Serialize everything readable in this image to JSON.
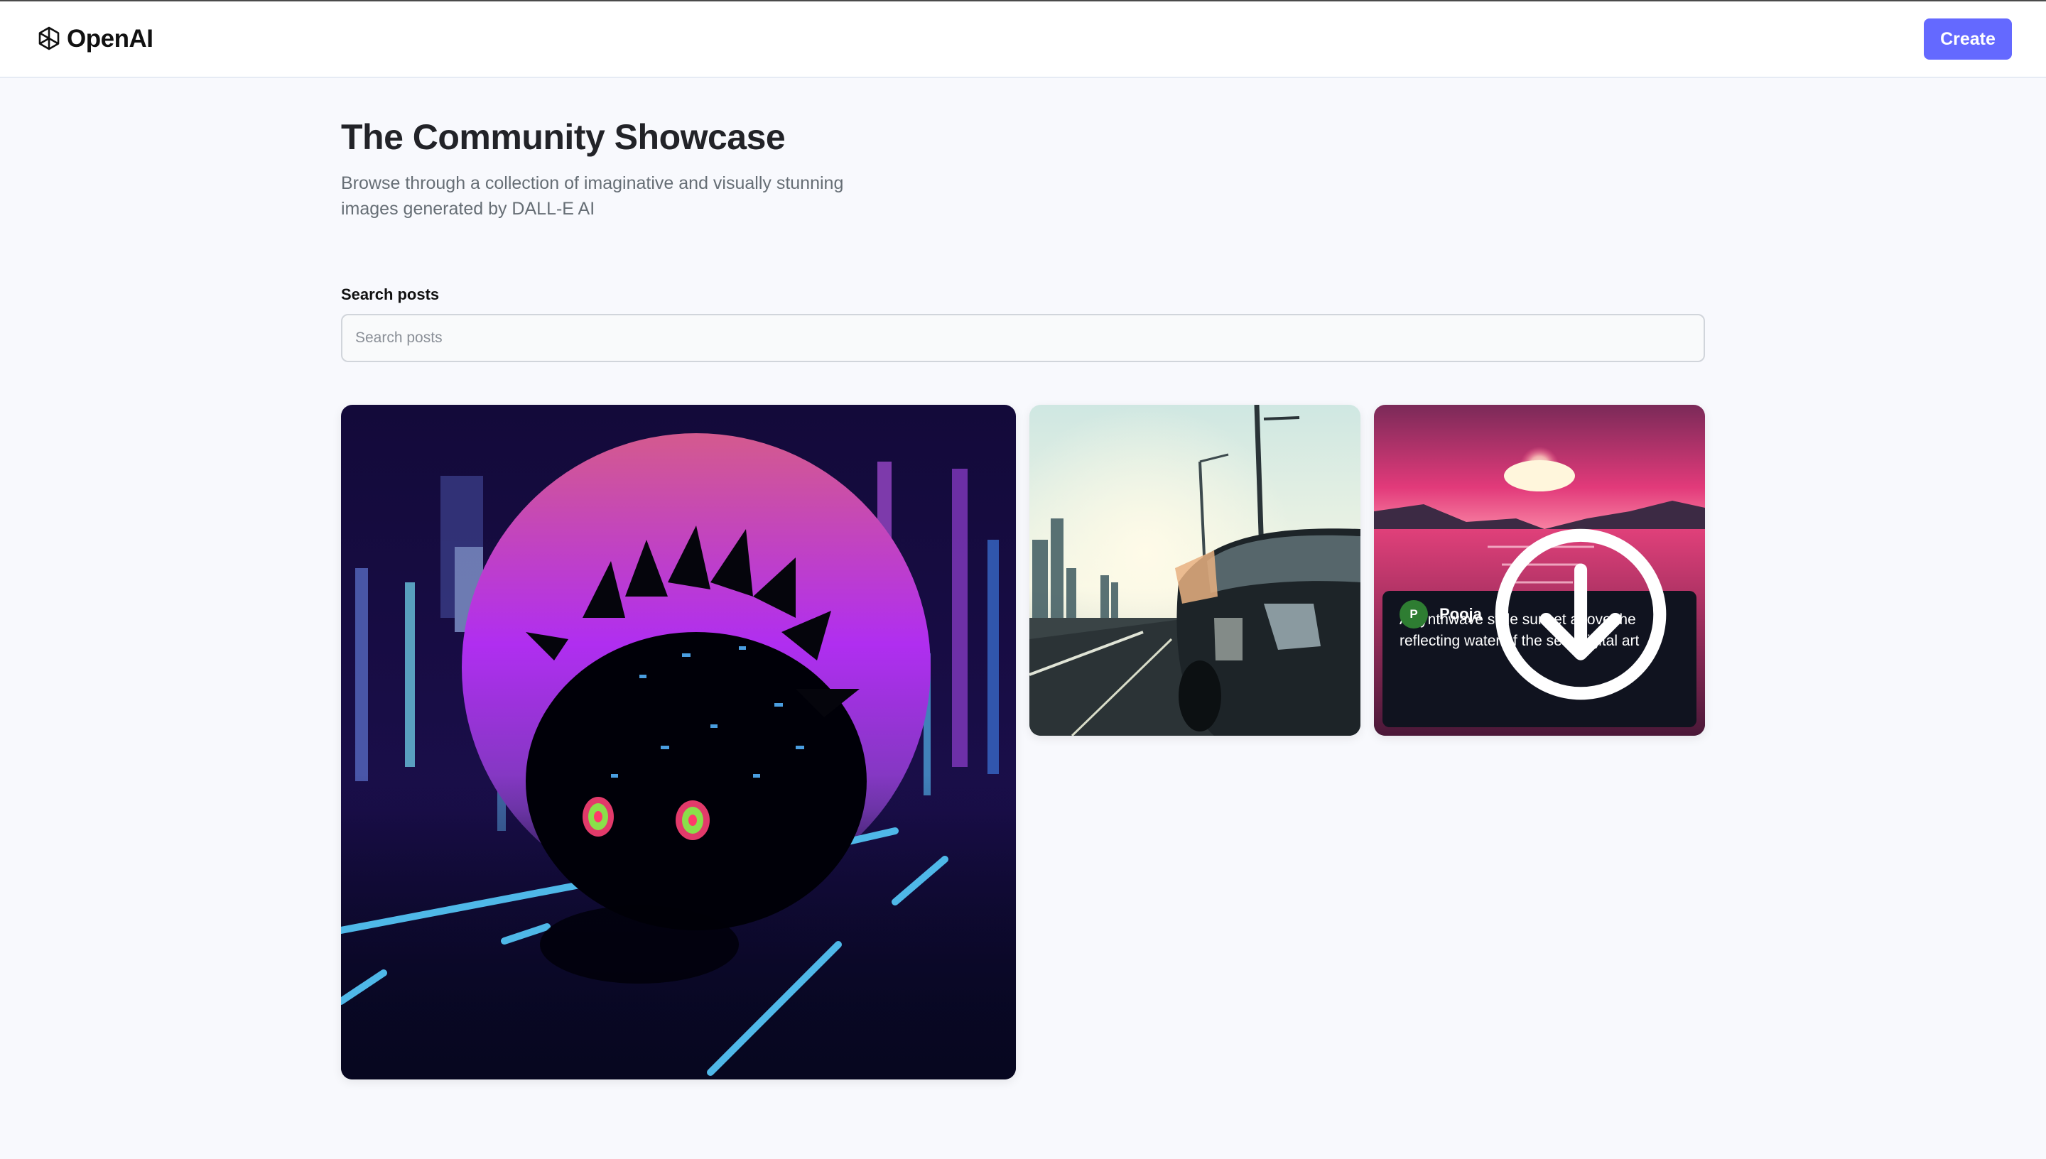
{
  "header": {
    "logo_text": "OpenAI",
    "create_label": "Create"
  },
  "page": {
    "title": "The Community Showcase",
    "subtitle": "Browse through a collection of imaginative and visually stunning images generated by DALL-E AI"
  },
  "search": {
    "label": "Search posts",
    "placeholder": "Search posts",
    "value": ""
  },
  "posts": [
    {
      "image": "synthwave hedgehog on neon road"
    },
    {
      "image": "car on highway at sunset"
    },
    {
      "image": "synthwave sunset over sea",
      "prompt": "A synthwave style sunset above the reflecting water of the sea, digital art",
      "author": "Pooja",
      "avatar_initial": "P",
      "avatar_color": "#2e7d32"
    }
  ],
  "colors": {
    "accent": "#6469ff",
    "background": "#f8f9fd",
    "overlay": "#10131f"
  }
}
